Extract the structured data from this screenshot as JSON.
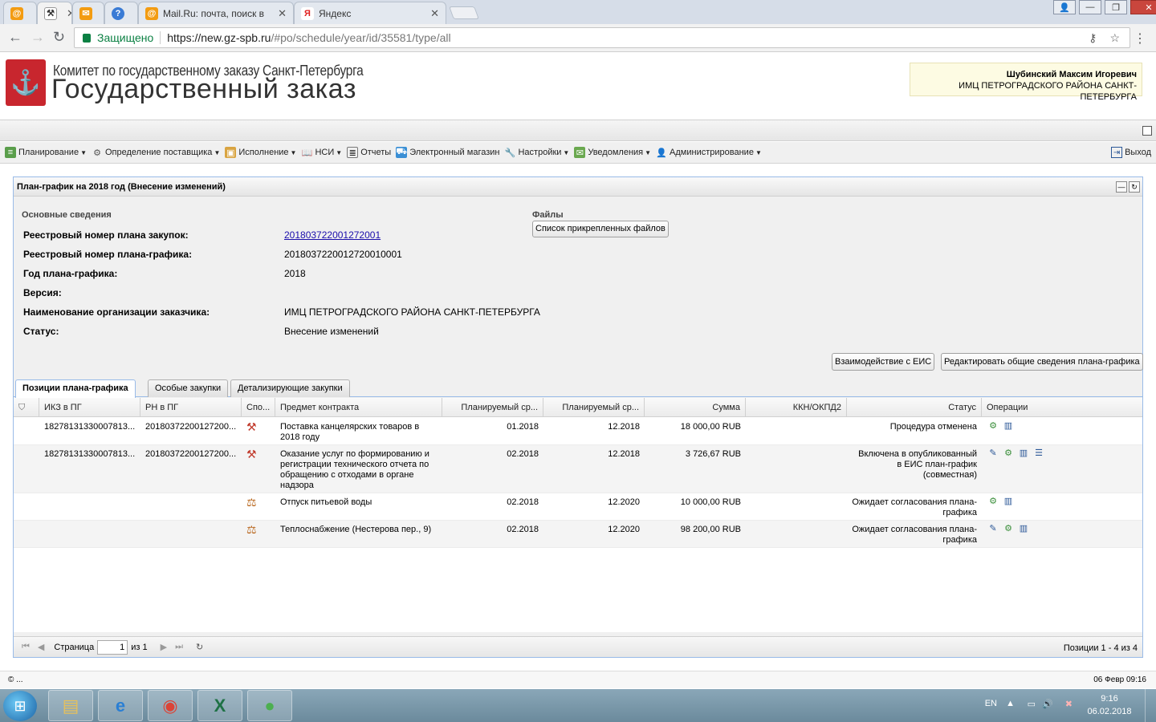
{
  "browser": {
    "tabs": [
      {
        "title": "",
        "icon": "at-icon"
      },
      {
        "title": "",
        "icon": "hammer-icon"
      },
      {
        "title": "",
        "icon": "mail-icon"
      },
      {
        "title": "",
        "icon": "info-icon"
      },
      {
        "title": "Mail.Ru: почта, поиск в",
        "icon": "at-icon"
      },
      {
        "title": "Яндекс",
        "icon": "yandex-icon"
      }
    ],
    "secure_label": "Защищено",
    "url_host": "https://new.gz-spb.ru",
    "url_path": "/#po/schedule/year/id/35581/type/all"
  },
  "header": {
    "committee": "Комитет по государственному заказу Санкт-Петербурга",
    "title": "Государственный заказ",
    "user_name": "Шубинский Максим Игоревич",
    "user_org": "ИМЦ ПЕТРОГРАДСКОГО РАЙОНА САНКТ-ПЕТЕРБУРГА"
  },
  "menu": {
    "items": [
      {
        "label": "Планирование",
        "dropdown": true
      },
      {
        "label": "Определение поставщика",
        "dropdown": true
      },
      {
        "label": "Исполнение",
        "dropdown": true
      },
      {
        "label": "НСИ",
        "dropdown": true
      },
      {
        "label": "Отчеты",
        "dropdown": false
      },
      {
        "label": "Электронный магазин",
        "dropdown": false
      },
      {
        "label": "Настройки",
        "dropdown": true
      },
      {
        "label": "Уведомления",
        "dropdown": true
      },
      {
        "label": "Администрирование",
        "dropdown": true
      }
    ],
    "exit_label": "Выход"
  },
  "panel": {
    "title": "План-график на 2018 год (Внесение изменений)",
    "section_label": "Основные сведения",
    "files_label": "Файлы",
    "files_button": "Список прикрепленных файлов",
    "fields": [
      {
        "label": "Реестровый номер плана закупок:",
        "value": "201803722001272001",
        "link": true
      },
      {
        "label": "Реестровый номер плана-графика:",
        "value": "2018037220012720010001",
        "link": false
      },
      {
        "label": "Год плана-графика:",
        "value": "2018",
        "link": false
      },
      {
        "label": "Версия:",
        "value": "",
        "link": false
      },
      {
        "label": "Наименование организации заказчика:",
        "value": "ИМЦ ПЕТРОГРАДСКОГО РАЙОНА САНКТ-ПЕТЕРБУРГА",
        "link": false
      },
      {
        "label": "Статус:",
        "value": "Внесение изменений",
        "link": false
      }
    ],
    "btn_eis": "Взаимодействие с ЕИС",
    "btn_edit": "Редактировать общие сведения плана-графика",
    "subtabs": [
      "Позиции плана-графика",
      "Особые закупки",
      "Детализирующие закупки"
    ]
  },
  "grid": {
    "columns": [
      "",
      "ИКЗ в ПГ",
      "РН в ПГ",
      "Спо...",
      "Предмет контракта",
      "Планируемый ср...",
      "Планируемый ср...",
      "Сумма",
      "ККН/ОКПД2",
      "Статус",
      "Операции"
    ],
    "rows": [
      {
        "ikz": "18278131330007813...",
        "rn": "20180372200127200...",
        "subject": "Поставка канцелярских товаров в 2018 году",
        "start": "01.2018",
        "end": "12.2018",
        "sum": "18 000,00 RUB",
        "okpd": "",
        "status": "Процедура отменена",
        "ops": [
          "gear-icon",
          "chart-icon"
        ]
      },
      {
        "ikz": "18278131330007813...",
        "rn": "20180372200127200...",
        "subject": "Оказание услуг по формированию и регистрации технического отчета по обращению с отходами в органе надзора",
        "start": "02.2018",
        "end": "12.2018",
        "sum": "3 726,67 RUB",
        "okpd": "",
        "status": "Включена в опубликованный в ЕИС план-график (совместная)",
        "ops": [
          "pencil-icon",
          "gear-icon",
          "chart-icon",
          "list-icon"
        ]
      },
      {
        "ikz": "",
        "rn": "",
        "subject": "Отпуск питьевой воды",
        "start": "02.2018",
        "end": "12.2020",
        "sum": "10 000,00 RUB",
        "okpd": "",
        "status": "Ожидает согласования плана-графика",
        "ops": [
          "gear-icon",
          "chart-icon"
        ]
      },
      {
        "ikz": "",
        "rn": "",
        "subject": "Теплоснабжение (Нестерова пер., 9)",
        "start": "02.2018",
        "end": "12.2020",
        "sum": "98 200,00 RUB",
        "okpd": "",
        "status": "Ожидает согласования плана-графика",
        "ops": [
          "pencil-icon",
          "gear-icon",
          "chart-icon"
        ]
      }
    ]
  },
  "pager": {
    "page_label": "Страница",
    "page_value": "1",
    "of_label": "из 1",
    "info": "Позиции 1 - 4 из 4"
  },
  "footer": {
    "left": "© ...",
    "right": "06 Февр 09:16"
  },
  "taskbar": {
    "lang": "EN",
    "time": "9:16",
    "date": "06.02.2018"
  },
  "colors": {
    "panel_border": "#99bbe8",
    "logo_red": "#c8262e",
    "secure_green": "#0b8043",
    "link": "#1a0dab"
  }
}
